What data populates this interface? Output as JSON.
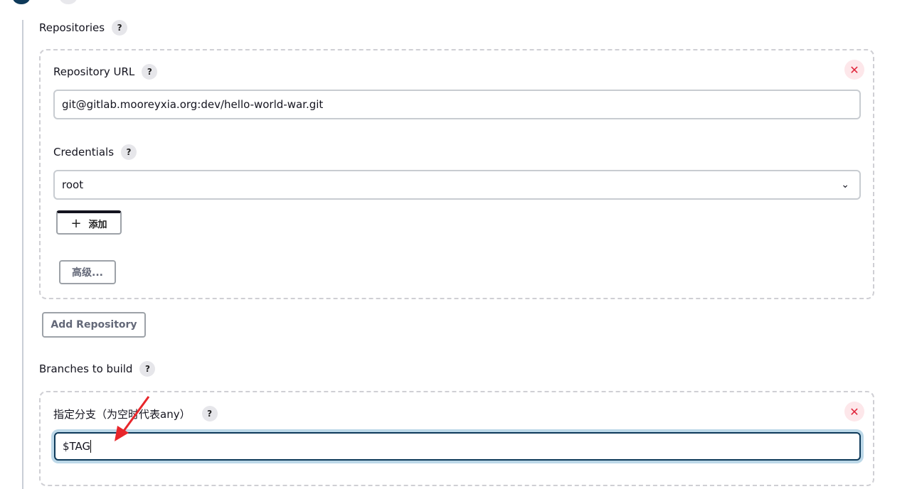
{
  "repositories": {
    "label": "Repositories",
    "help": "?",
    "url_label": "Repository URL",
    "url_value": "git@gitlab.mooreyxia.org:dev/hello-world-war.git",
    "credentials_label": "Credentials",
    "credentials_value": "root",
    "add_label": "添加",
    "add_icon": "+",
    "advanced_label": "高级...",
    "remove": "✕"
  },
  "add_repository_label": "Add Repository",
  "branches": {
    "label": "Branches to build",
    "help": "?",
    "branch_label": "指定分支（为空时代表any）",
    "branch_value": "$TAG",
    "remove": "✕"
  },
  "annotation_arrow_color": "#e8262b"
}
